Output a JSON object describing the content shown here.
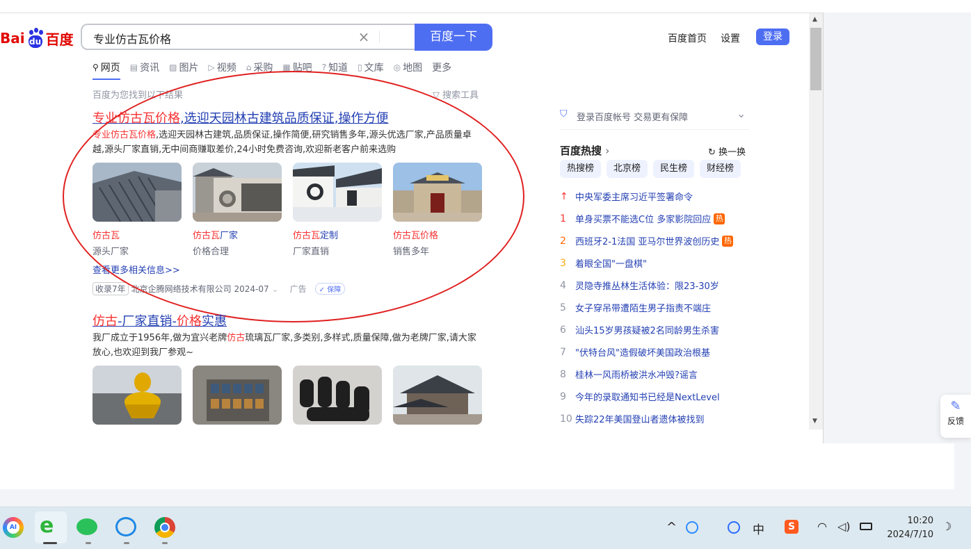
{
  "header": {
    "logo_bai": "Bai",
    "logo_du": "du",
    "logo_baidu": "百度",
    "search_value": "专业仿古瓦价格",
    "search_button": "百度一下",
    "home_link": "百度首页",
    "settings_link": "设置",
    "login_button": "登录"
  },
  "tabs": [
    "网页",
    "资讯",
    "图片",
    "视频",
    "采购",
    "贴吧",
    "知道",
    "文库",
    "地图",
    "更多"
  ],
  "results_info": "百度为您找到以下结果",
  "search_tools": "搜索工具",
  "result1": {
    "title_em1": "专业仿古瓦价格",
    "title_rest": ",选迎天园林古建筑品质保证,操作方便",
    "desc_em": "专业仿古瓦价格",
    "desc_rest": ",选迎天园林古建筑,品质保证,操作简便,研究销售多年,源头优选厂家,产品质量卓越,源头厂家直销,无中间商赚取差价,24小时免费咨询,欢迎新老客户前来选购",
    "items": [
      {
        "cap_em": "仿古瓦",
        "cap_rest": "",
        "sub": "源头厂家"
      },
      {
        "cap_em": "仿古瓦",
        "cap_rest": "厂家",
        "sub": "价格合理"
      },
      {
        "cap_em": "仿古瓦",
        "cap_rest": "定制",
        "sub": "厂家直销"
      },
      {
        "cap_em": "仿古瓦价格",
        "cap_rest": "",
        "sub": "销售多年"
      }
    ],
    "more_link": "查看更多相关信息>>",
    "footer_badge": "收录7年",
    "footer_company": "北京企腾网络技术有限公司 2024-07",
    "footer_ad": "广告",
    "footer_guarantee": "保障"
  },
  "result2": {
    "title_em1": "仿古",
    "title_mid": "-厂家直销-",
    "title_em2": "价格",
    "title_rest": "实惠",
    "desc_a": "我厂成立于1956年,做为宜兴老牌",
    "desc_em": "仿古",
    "desc_b": "琉璃瓦厂家,多类别,多样式,质量保障,做为老牌厂家,请大家放心,也欢迎到我厂参观~"
  },
  "right": {
    "login_promo": "登录百度帐号 交易更有保障",
    "hot_title": "百度热搜",
    "refresh": "换一换",
    "chips": [
      "热搜榜",
      "北京榜",
      "民生榜",
      "财经榜"
    ],
    "hot_items": [
      {
        "num": "↑",
        "text": "中央军委主席习近平签署命令",
        "badge": ""
      },
      {
        "num": "1",
        "text": "单身买票不能选C位 多家影院回应",
        "badge": "热"
      },
      {
        "num": "2",
        "text": "西班牙2-1法国 亚马尔世界波创历史",
        "badge": "热"
      },
      {
        "num": "3",
        "text": "着眼全国\"一盘棋\"",
        "badge": ""
      },
      {
        "num": "4",
        "text": "灵隐寺推丛林生活体验：限23-30岁",
        "badge": ""
      },
      {
        "num": "5",
        "text": "女子穿吊带遭陌生男子指责不端庄",
        "badge": ""
      },
      {
        "num": "6",
        "text": "汕头15岁男孩疑被2名同龄男生杀害",
        "badge": ""
      },
      {
        "num": "7",
        "text": "\"伏特台风\"造假破坏美国政治根基",
        "badge": ""
      },
      {
        "num": "8",
        "text": "桂林一风雨桥被洪水冲毁?谣言",
        "badge": ""
      },
      {
        "num": "9",
        "text": "今年的录取通知书已经是NextLevel",
        "badge": ""
      },
      {
        "num": "10",
        "text": "失踪22年美国登山者遗体被找到",
        "badge": ""
      }
    ],
    "hot_num_colors": [
      "#f73131",
      "#f73131",
      "#ff6600",
      "#faa90e"
    ]
  },
  "feedback": "反馈",
  "taskbar": {
    "ime": "中",
    "time": "10:20",
    "date": "2024/7/10"
  }
}
